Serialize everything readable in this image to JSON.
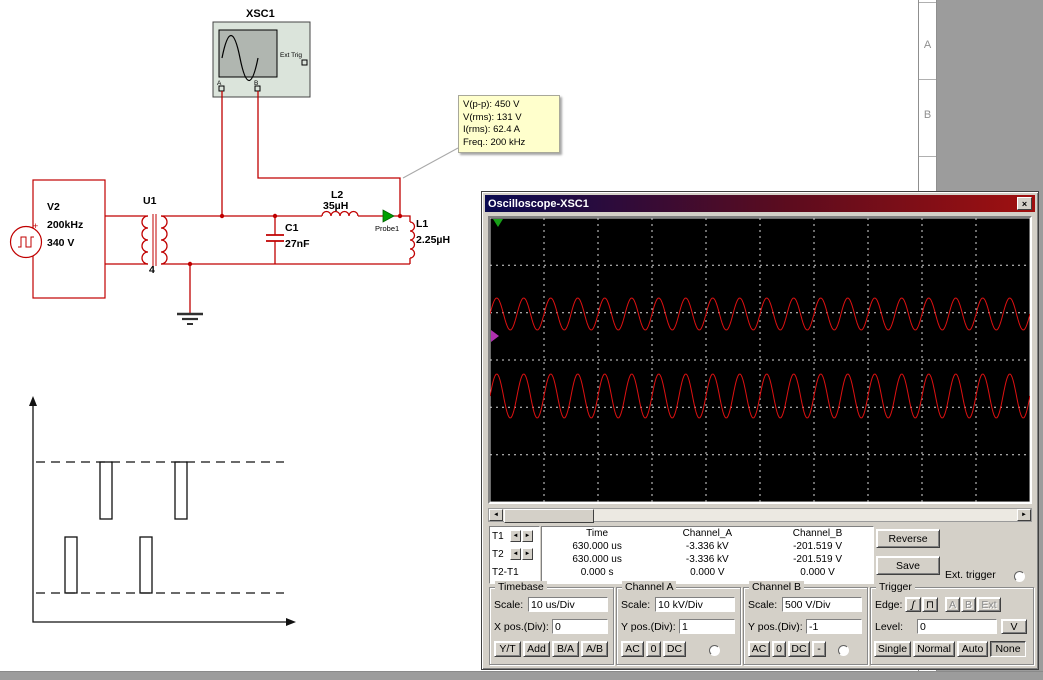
{
  "schematic": {
    "instrument_icon": {
      "label": "XSC1",
      "ext_trig": "Ext Trig",
      "term_a": "A",
      "term_b": "B"
    },
    "tooltip": {
      "lines": [
        "V(p-p): 450 V",
        "V(rms): 131 V",
        "I(rms): 62.4 A",
        "Freq.: 200 kHz"
      ]
    },
    "v2": {
      "ref": "V2",
      "freq": "200kHz",
      "voltage": "340 V",
      "plus": "+"
    },
    "u1": {
      "ref": "U1",
      "ratio": "4"
    },
    "c1": {
      "ref": "C1",
      "value": "27nF"
    },
    "l2": {
      "ref": "L2",
      "value": "35µH"
    },
    "l1": {
      "ref": "L1",
      "value": "2.25µH"
    },
    "probe": {
      "label": "Probe1"
    }
  },
  "sheet": {
    "row_a": "A",
    "row_b": "B"
  },
  "osc": {
    "title": "Oscilloscope-XSC1",
    "icons": {
      "close": "×",
      "scroll_left": "◄",
      "scroll_right": "►",
      "cursor_left": "◄",
      "cursor_right": "►",
      "edge_rise": "ʃ",
      "edge_pulse": "⊓"
    },
    "cursor_table": {
      "headers": [
        "Time",
        "Channel_A",
        "Channel_B"
      ],
      "rows": [
        {
          "label": "T1",
          "time": "630.000 us",
          "a": "-3.336 kV",
          "b": "-201.519 V"
        },
        {
          "label": "T2",
          "time": "630.000 us",
          "a": "-3.336 kV",
          "b": "-201.519 V"
        },
        {
          "label": "T2-T1",
          "time": "0.000 s",
          "a": "0.000 V",
          "b": "0.000 V"
        }
      ]
    },
    "buttons": {
      "reverse": "Reverse",
      "save": "Save",
      "ext_trigger": "Ext. trigger"
    },
    "timebase": {
      "title": "Timebase",
      "scale_label": "Scale:",
      "scale": "10 us/Div",
      "xpos_label": "X pos.(Div):",
      "xpos": "0",
      "modes": [
        "Y/T",
        "Add",
        "B/A",
        "A/B"
      ]
    },
    "channel_a": {
      "title": "Channel A",
      "scale_label": "Scale:",
      "scale": "10 kV/Div",
      "ypos_label": "Y pos.(Div):",
      "ypos": "1",
      "couplings": [
        "AC",
        "0",
        "DC"
      ]
    },
    "channel_b": {
      "title": "Channel B",
      "scale_label": "Scale:",
      "scale": "500 V/Div",
      "ypos_label": "Y pos.(Div):",
      "ypos": "-1",
      "couplings": [
        "AC",
        "0",
        "DC",
        "-"
      ]
    },
    "trigger": {
      "title": "Trigger",
      "edge_label": "Edge:",
      "sources": [
        "A",
        "B",
        "Ext"
      ],
      "level_label": "Level:",
      "level": "0",
      "level_unit": "V",
      "modes": [
        "Single",
        "Normal",
        "Auto",
        "None"
      ]
    },
    "waveform": {
      "color": "#dd1111",
      "cycles": 20,
      "ch_a": {
        "center": 96,
        "amplitude": 16
      },
      "ch_b": {
        "center": 178,
        "amplitude": 22
      }
    }
  }
}
